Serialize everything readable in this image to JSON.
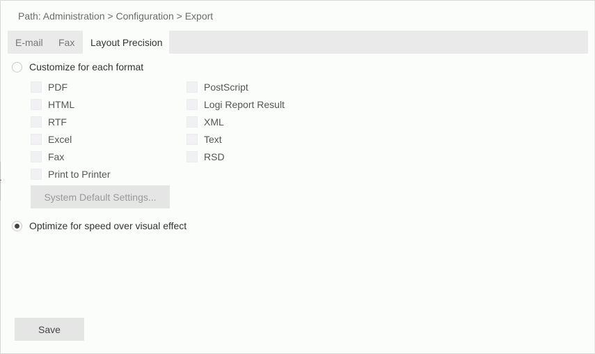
{
  "breadcrumb": "Path: Administration > Configuration > Export",
  "tabs": [
    {
      "label": "E-mail",
      "active": false
    },
    {
      "label": "Fax",
      "active": false
    },
    {
      "label": "Layout Precision",
      "active": true
    }
  ],
  "options": {
    "customize": {
      "label": "Customize for each format",
      "selected": false
    },
    "optimize": {
      "label": "Optimize for speed over visual effect",
      "selected": true
    }
  },
  "formats_left": [
    {
      "label": "PDF",
      "checked": false
    },
    {
      "label": "HTML",
      "checked": false
    },
    {
      "label": "RTF",
      "checked": false
    },
    {
      "label": "Excel",
      "checked": false
    },
    {
      "label": "Fax",
      "checked": false
    },
    {
      "label": "Print to Printer",
      "checked": false
    }
  ],
  "formats_right": [
    {
      "label": "PostScript",
      "checked": false
    },
    {
      "label": "Logi Report Result",
      "checked": false
    },
    {
      "label": "XML",
      "checked": false
    },
    {
      "label": "Text",
      "checked": false
    },
    {
      "label": "RSD",
      "checked": false
    }
  ],
  "buttons": {
    "system_default": "System Default Settings...",
    "save": "Save"
  }
}
